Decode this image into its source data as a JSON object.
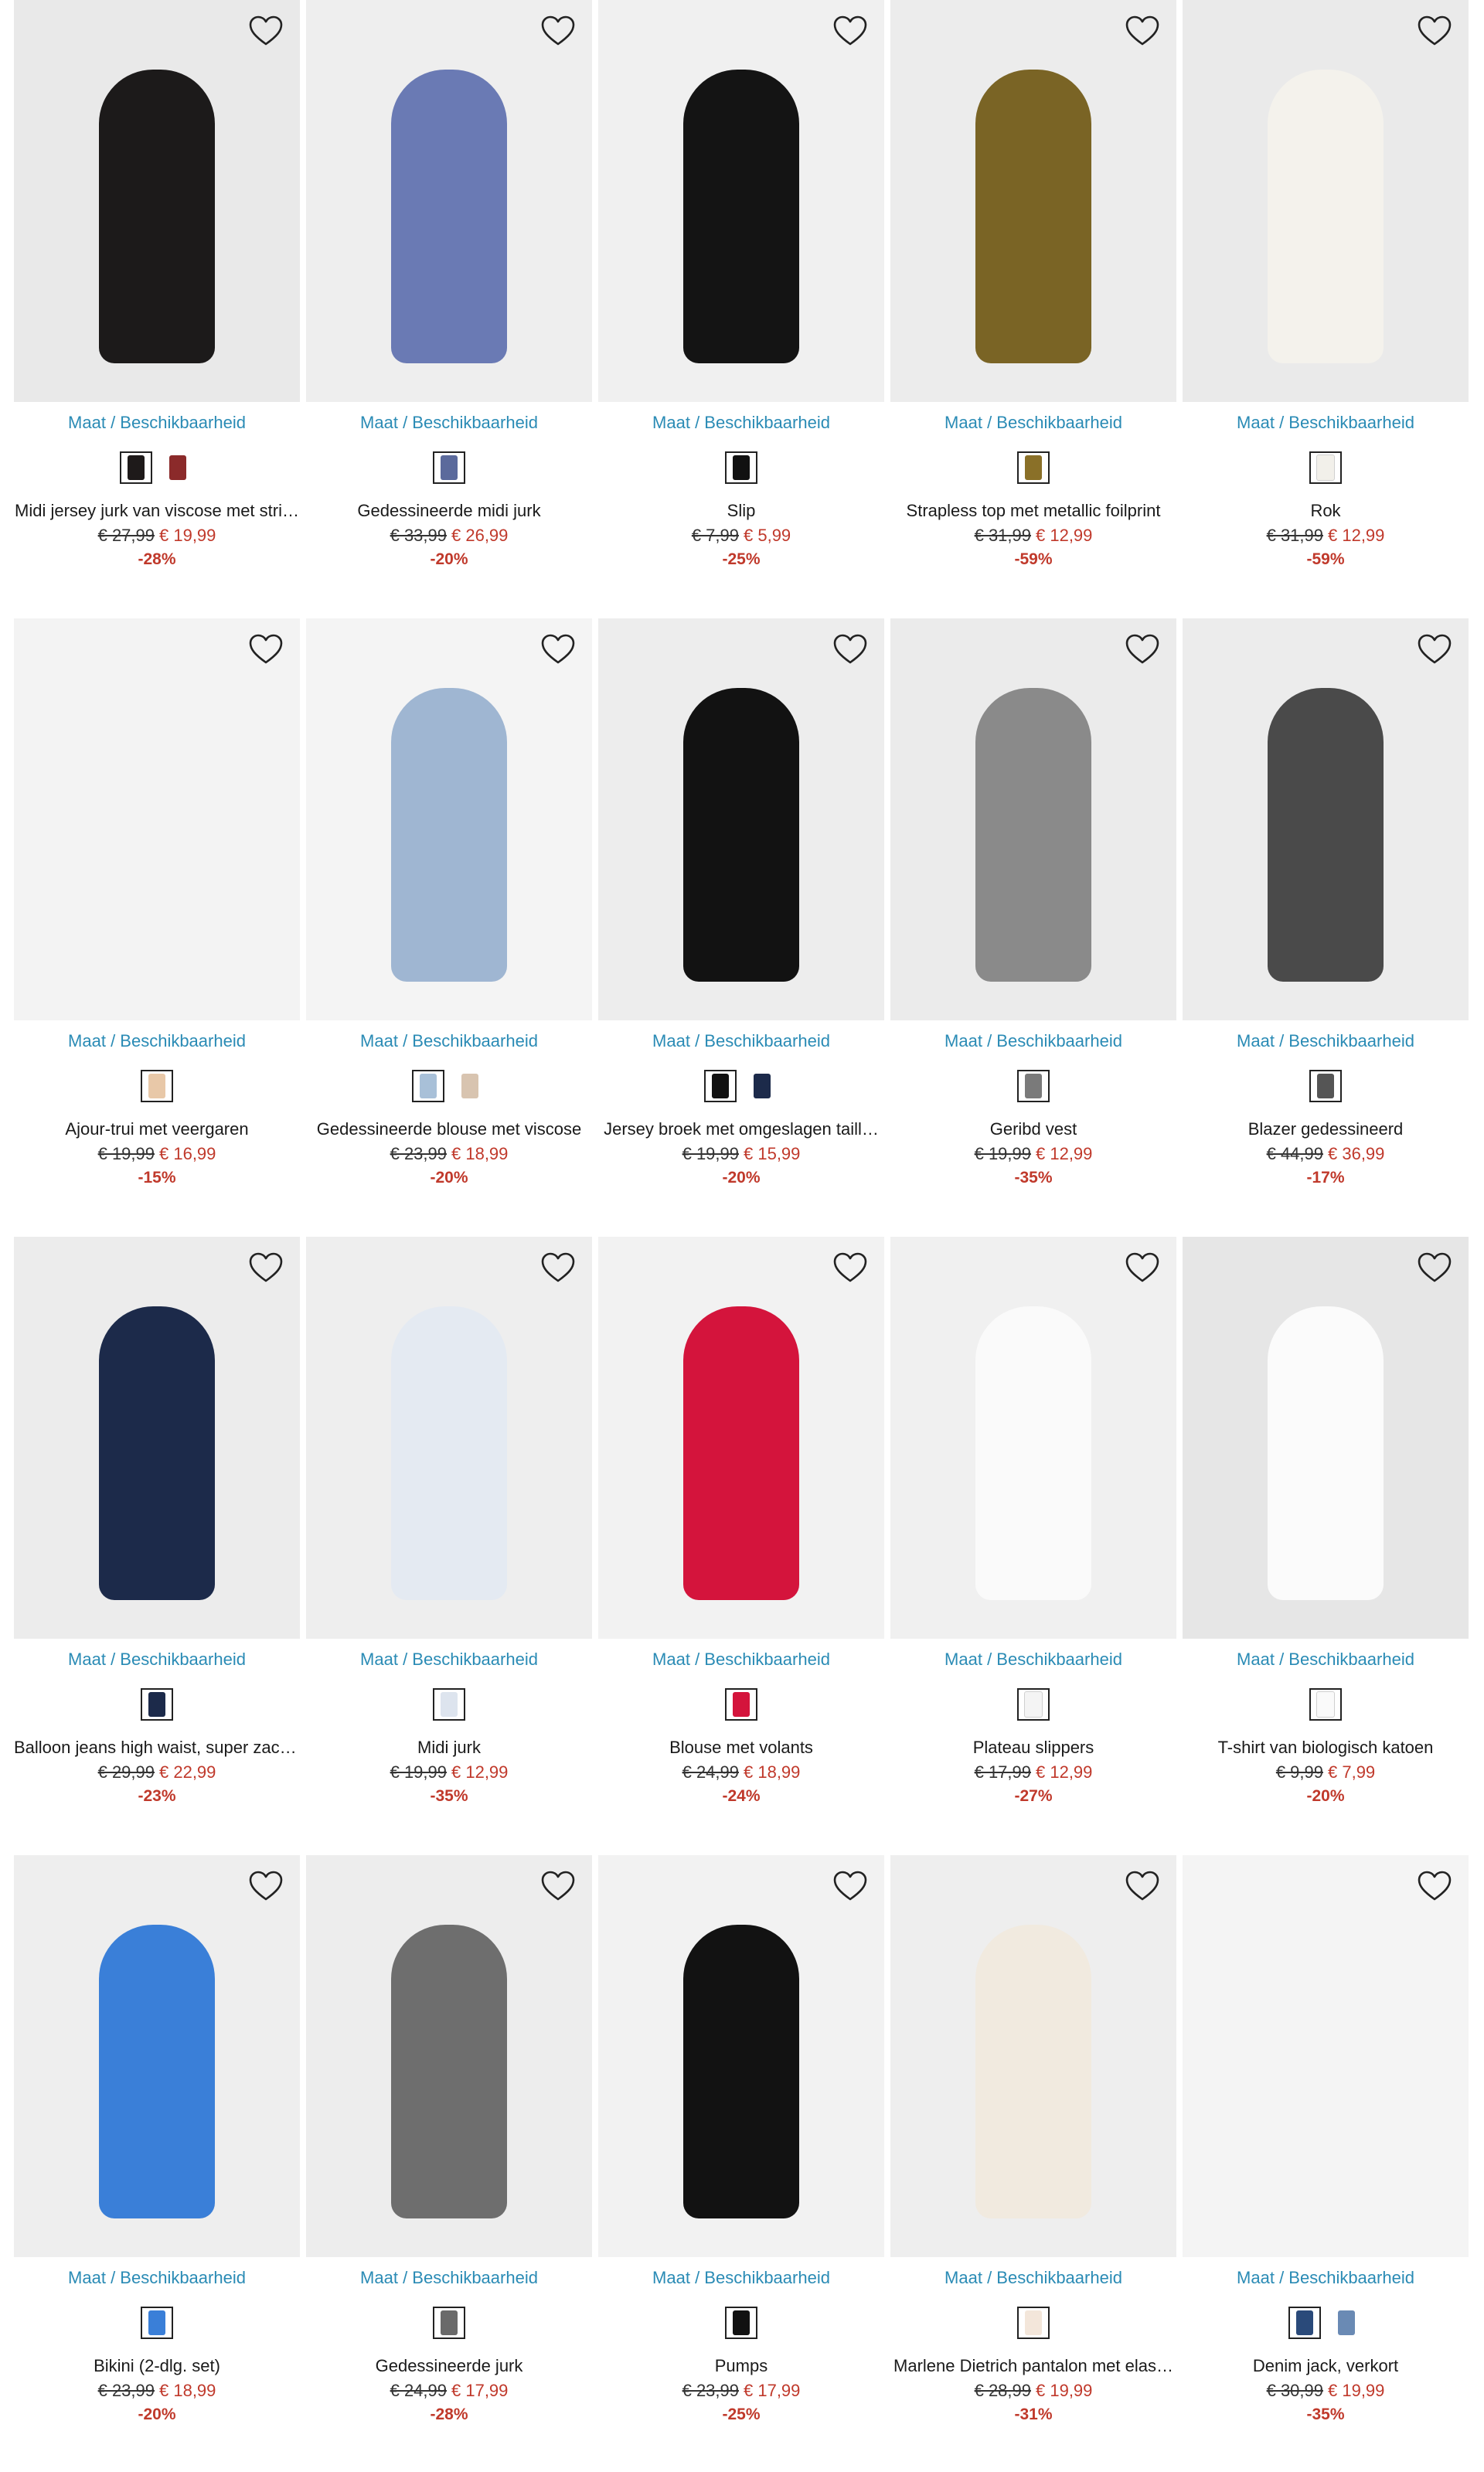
{
  "common": {
    "size_link": "Maat / Beschikbaarheid"
  },
  "products": [
    {
      "name": "Midi jersey jurk van viscose met stri…",
      "old": "€ 27,99",
      "new": "€ 19,99",
      "discount": "-28%",
      "swatches": [
        "#1e1a1a",
        "#8b2a2a"
      ],
      "img": "#e9e9e9",
      "fig": "#1c1a1a"
    },
    {
      "name": "Gedessineerde midi jurk",
      "old": "€ 33,99",
      "new": "€ 26,99",
      "discount": "-20%",
      "swatches": [
        "#5b6a9c"
      ],
      "img": "#eeeeee",
      "fig": "#6a7ab4"
    },
    {
      "name": "Slip",
      "old": "€ 7,99",
      "new": "€ 5,99",
      "discount": "-25%",
      "swatches": [
        "#111111"
      ],
      "img": "#f0f0f0",
      "fig": "#141414"
    },
    {
      "name": "Strapless top met metallic foilprint",
      "old": "€ 31,99",
      "new": "€ 12,99",
      "discount": "-59%",
      "swatches": [
        "#8a7028"
      ],
      "img": "#ececec",
      "fig": "#7a6425"
    },
    {
      "name": "Rok",
      "old": "€ 31,99",
      "new": "€ 12,99",
      "discount": "-59%",
      "swatches": [
        "#f2f0ea"
      ],
      "img": "#eaeaea",
      "fig": "#f4f2ec"
    },
    {
      "name": "Ajour-trui met veergaren",
      "old": "€ 19,99",
      "new": "€ 16,99",
      "discount": "-15%",
      "swatches": [
        "#e8c8a8"
      ],
      "img": "#f3f3f3",
      "fig": ""
    },
    {
      "name": "Gedessineerde blouse met viscose",
      "old": "€ 23,99",
      "new": "€ 18,99",
      "discount": "-20%",
      "swatches": [
        "#a8c0d8",
        "#d8c4b0"
      ],
      "img": "#f4f4f4",
      "fig": "#9fb6d2"
    },
    {
      "name": "Jersey broek met omgeslagen taill…",
      "old": "€ 19,99",
      "new": "€ 15,99",
      "discount": "-20%",
      "swatches": [
        "#111111",
        "#1c2a4a"
      ],
      "img": "#ededed",
      "fig": "#121212"
    },
    {
      "name": "Geribd vest",
      "old": "€ 19,99",
      "new": "€ 12,99",
      "discount": "-35%",
      "swatches": [
        "#7a7a7a"
      ],
      "img": "#ebebeb",
      "fig": "#8a8a8a"
    },
    {
      "name": "Blazer gedessineerd",
      "old": "€ 44,99",
      "new": "€ 36,99",
      "discount": "-17%",
      "swatches": [
        "#555555"
      ],
      "img": "#ececec",
      "fig": "#4a4a4a"
    },
    {
      "name": "Balloon jeans high waist, super zach…",
      "old": "€ 29,99",
      "new": "€ 22,99",
      "discount": "-23%",
      "swatches": [
        "#1c2a4a"
      ],
      "img": "#ececec",
      "fig": "#1c2a4a"
    },
    {
      "name": "Midi jurk",
      "old": "€ 19,99",
      "new": "€ 12,99",
      "discount": "-35%",
      "swatches": [
        "#dde4ee"
      ],
      "img": "#eeeeee",
      "fig": "#e4eaf2"
    },
    {
      "name": "Blouse met volants",
      "old": "€ 24,99",
      "new": "€ 18,99",
      "discount": "-24%",
      "swatches": [
        "#d4143c"
      ],
      "img": "#f2f2f2",
      "fig": "#d4143c"
    },
    {
      "name": "Plateau slippers",
      "old": "€ 17,99",
      "new": "€ 12,99",
      "discount": "-27%",
      "swatches": [
        "#f4f4f4"
      ],
      "img": "#f0f0f0",
      "fig": "#fafafa"
    },
    {
      "name": "T-shirt van biologisch katoen",
      "old": "€ 9,99",
      "new": "€ 7,99",
      "discount": "-20%",
      "swatches": [
        "#fafafa"
      ],
      "img": "#e6e6e6",
      "fig": "#fbfbfb"
    },
    {
      "name": "Bikini (2-dlg. set)",
      "old": "€ 23,99",
      "new": "€ 18,99",
      "discount": "-20%",
      "swatches": [
        "#3a7fd8"
      ],
      "img": "#eeeeee",
      "fig": "#3a7fd8"
    },
    {
      "name": "Gedessineerde jurk",
      "old": "€ 24,99",
      "new": "€ 17,99",
      "discount": "-28%",
      "swatches": [
        "#6a6a6a"
      ],
      "img": "#ededed",
      "fig": "#6e6e6e"
    },
    {
      "name": "Pumps",
      "old": "€ 23,99",
      "new": "€ 17,99",
      "discount": "-25%",
      "swatches": [
        "#111111"
      ],
      "img": "#f2f2f2",
      "fig": "#121212"
    },
    {
      "name": "Marlene Dietrich pantalon met elas…",
      "old": "€ 28,99",
      "new": "€ 19,99",
      "discount": "-31%",
      "swatches": [
        "#f3e6da"
      ],
      "img": "#eeeeee",
      "fig": "#f1eadf"
    },
    {
      "name": "Denim jack, verkort",
      "old": "€ 30,99",
      "new": "€ 19,99",
      "discount": "-35%",
      "swatches": [
        "#2a4a7a",
        "#6a8ab4"
      ],
      "img": "#f4f4f4",
      "fig": ""
    }
  ]
}
